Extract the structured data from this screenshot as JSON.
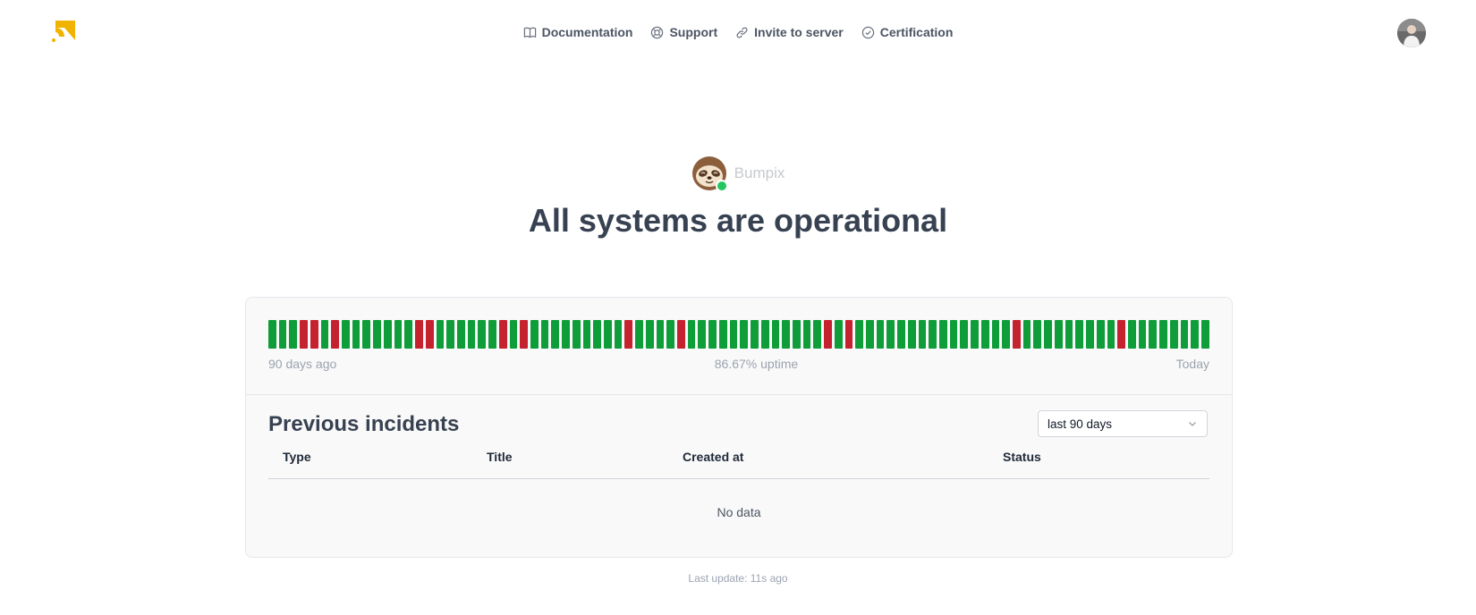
{
  "nav": {
    "items": [
      {
        "label": "Documentation",
        "icon": "book-icon"
      },
      {
        "label": "Support",
        "icon": "lifebuoy-icon"
      },
      {
        "label": "Invite to server",
        "icon": "link-icon"
      },
      {
        "label": "Certification",
        "icon": "check-circle-icon"
      }
    ]
  },
  "brand": {
    "name": "Bumpix",
    "status_color": "#22c55e"
  },
  "headline": "All systems are operational",
  "uptime": {
    "start_label": "90 days ago",
    "summary": "86.67% uptime",
    "end_label": "Today",
    "colors": {
      "up": "#0f9d3a",
      "down": "#c5222f"
    },
    "days": [
      "up",
      "up",
      "up",
      "down",
      "down",
      "up",
      "down",
      "up",
      "up",
      "up",
      "up",
      "up",
      "up",
      "up",
      "down",
      "down",
      "up",
      "up",
      "up",
      "up",
      "up",
      "up",
      "down",
      "up",
      "down",
      "up",
      "up",
      "up",
      "up",
      "up",
      "up",
      "up",
      "up",
      "up",
      "down",
      "up",
      "up",
      "up",
      "up",
      "down",
      "up",
      "up",
      "up",
      "up",
      "up",
      "up",
      "up",
      "up",
      "up",
      "up",
      "up",
      "up",
      "up",
      "down",
      "up",
      "down",
      "up",
      "up",
      "up",
      "up",
      "up",
      "up",
      "up",
      "up",
      "up",
      "up",
      "up",
      "up",
      "up",
      "up",
      "up",
      "down",
      "up",
      "up",
      "up",
      "up",
      "up",
      "up",
      "up",
      "up",
      "up",
      "down",
      "up",
      "up",
      "up",
      "up",
      "up",
      "up",
      "up",
      "up"
    ]
  },
  "incidents": {
    "title": "Previous incidents",
    "filter": "last 90 days",
    "columns": [
      "Type",
      "Title",
      "Created at",
      "Status"
    ],
    "empty_text": "No data"
  },
  "footer": {
    "last_update": "Last update: 11s ago"
  }
}
